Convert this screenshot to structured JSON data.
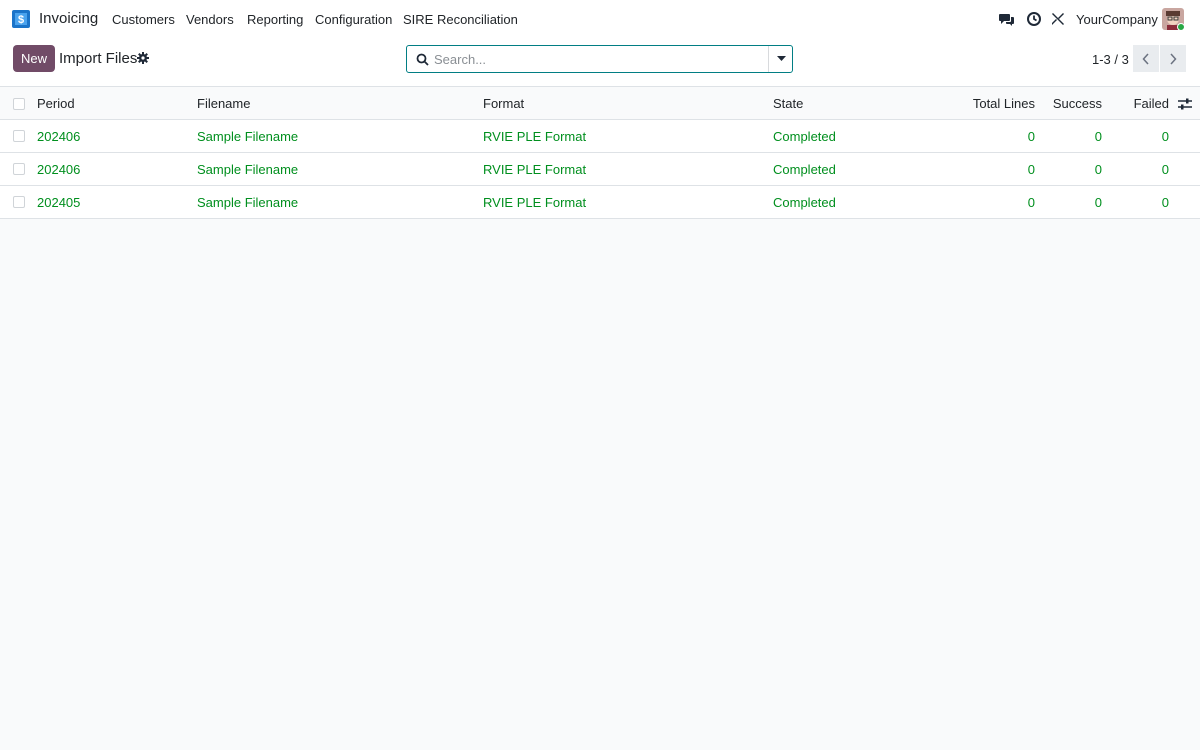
{
  "navbar": {
    "app_name": "Invoicing",
    "menu": [
      "Customers",
      "Vendors",
      "Reporting",
      "Configuration",
      "SIRE Reconciliation"
    ],
    "company": "YourCompany"
  },
  "control_panel": {
    "new_label": "New",
    "title": "Import Files",
    "search_placeholder": "Search...",
    "pager": "1-3 / 3"
  },
  "table": {
    "columns": [
      "Period",
      "Filename",
      "Format",
      "State",
      "Total Lines",
      "Success",
      "Failed"
    ],
    "rows": [
      {
        "period": "202406",
        "filename": "Sample Filename",
        "format": "RVIE PLE Format",
        "state": "Completed",
        "total_lines": "0",
        "success": "0",
        "failed": "0"
      },
      {
        "period": "202406",
        "filename": "Sample Filename",
        "format": "RVIE PLE Format",
        "state": "Completed",
        "total_lines": "0",
        "success": "0",
        "failed": "0"
      },
      {
        "period": "202405",
        "filename": "Sample Filename",
        "format": "RVIE PLE Format",
        "state": "Completed",
        "total_lines": "0",
        "success": "0",
        "failed": "0"
      }
    ]
  },
  "colors": {
    "brand": "#714b67",
    "link_green": "#008f1e",
    "search_border": "#017e84"
  },
  "icons": {
    "app": "invoice-dollar-icon",
    "chat": "chat-bubbles-icon",
    "activity": "clock-icon",
    "debug": "tools-icon",
    "settings": "gear-icon",
    "search": "search-icon",
    "toggle": "caret-down-icon",
    "pager_prev": "chevron-left-icon",
    "pager_next": "chevron-right-icon",
    "optional_columns": "sliders-icon"
  }
}
